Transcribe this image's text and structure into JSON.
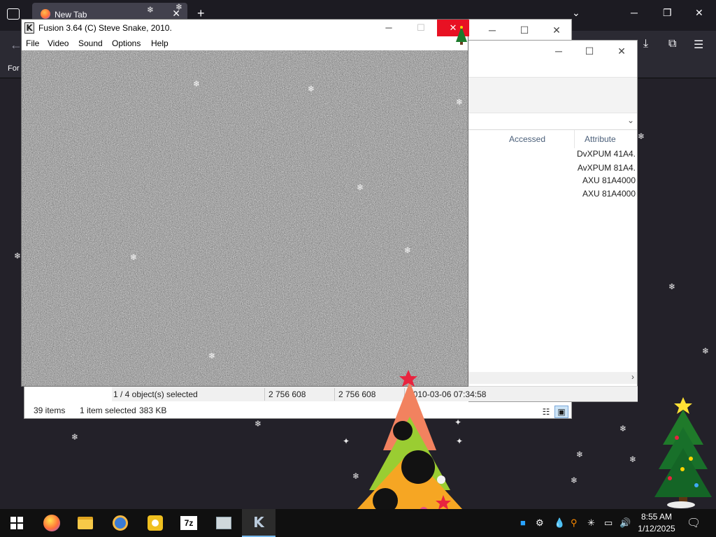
{
  "firefox": {
    "tab_title": "New Tab",
    "bookmark_label": "For"
  },
  "explorer_back": {
    "status_items": "39 items",
    "status_selected": "1 item selected",
    "status_size": "383 KB"
  },
  "explorer_front": {
    "columns": [
      "Accessed",
      "Attribute"
    ],
    "attributes": [
      "DvXPUM 41A4.",
      "AvXPUM 81A4.",
      "AXU 81A4000",
      "AXU 81A4000"
    ],
    "status": {
      "selection": "1 / 4 object(s) selected",
      "size1": "2 756 608",
      "size2": "2 756 608",
      "date": "2010-03-06 07:34:58"
    }
  },
  "fusion": {
    "title": "Fusion 3.64 (C) Steve Snake, 2010.",
    "icon_letter": "K",
    "menu": [
      "File",
      "Video",
      "Sound",
      "Options",
      "Help"
    ]
  },
  "taskbar": {
    "time": "8:55 AM",
    "date": "1/12/2025",
    "apps": [
      "start-icon",
      "firefox-icon",
      "file-explorer-icon",
      "app-icon",
      "media-player-icon",
      "7zip-icon",
      "app-icon",
      "fusion-icon"
    ],
    "sevenzip_label": "7z"
  },
  "colors": {
    "desktop": "#232129",
    "close_red": "#e81123",
    "taskbar": "#101010",
    "accent_blue": "#76b9ed"
  }
}
